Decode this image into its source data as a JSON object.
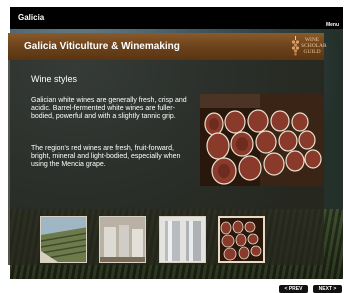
{
  "app": {
    "title": "Galicia",
    "menu_label": "Menu"
  },
  "panel": {
    "title": "Galicia Viticulture & Winemaking",
    "logo_text": [
      "WINE",
      "SCHOLAR",
      "GUILD"
    ],
    "section_title": "Wine styles",
    "paragraph1": "Galician white wines are generally fresh, crisp and acidic. Barrel-fermented white wines are fuller-bodied, powerful and with a slightly tannic grip.",
    "paragraph2": "The region's red wines are fresh, fruit-forward, bright, mineral and light-bodied, especially when using the Mencia grape."
  },
  "thumbnails": [
    {
      "subject": "terraced-vineyard",
      "selected": false
    },
    {
      "subject": "winery-steel-tanks",
      "selected": false
    },
    {
      "subject": "steel-fermentation-tanks",
      "selected": false
    },
    {
      "subject": "wine-barrels",
      "selected": true
    }
  ],
  "navigation": {
    "prev_label": "< PREV",
    "next_label": "NEXT >"
  },
  "colors": {
    "header_brown": "#6b421c",
    "panel_overlay": "#26261e",
    "topbar": "#000000",
    "logo_gold": "#f0c89a"
  }
}
